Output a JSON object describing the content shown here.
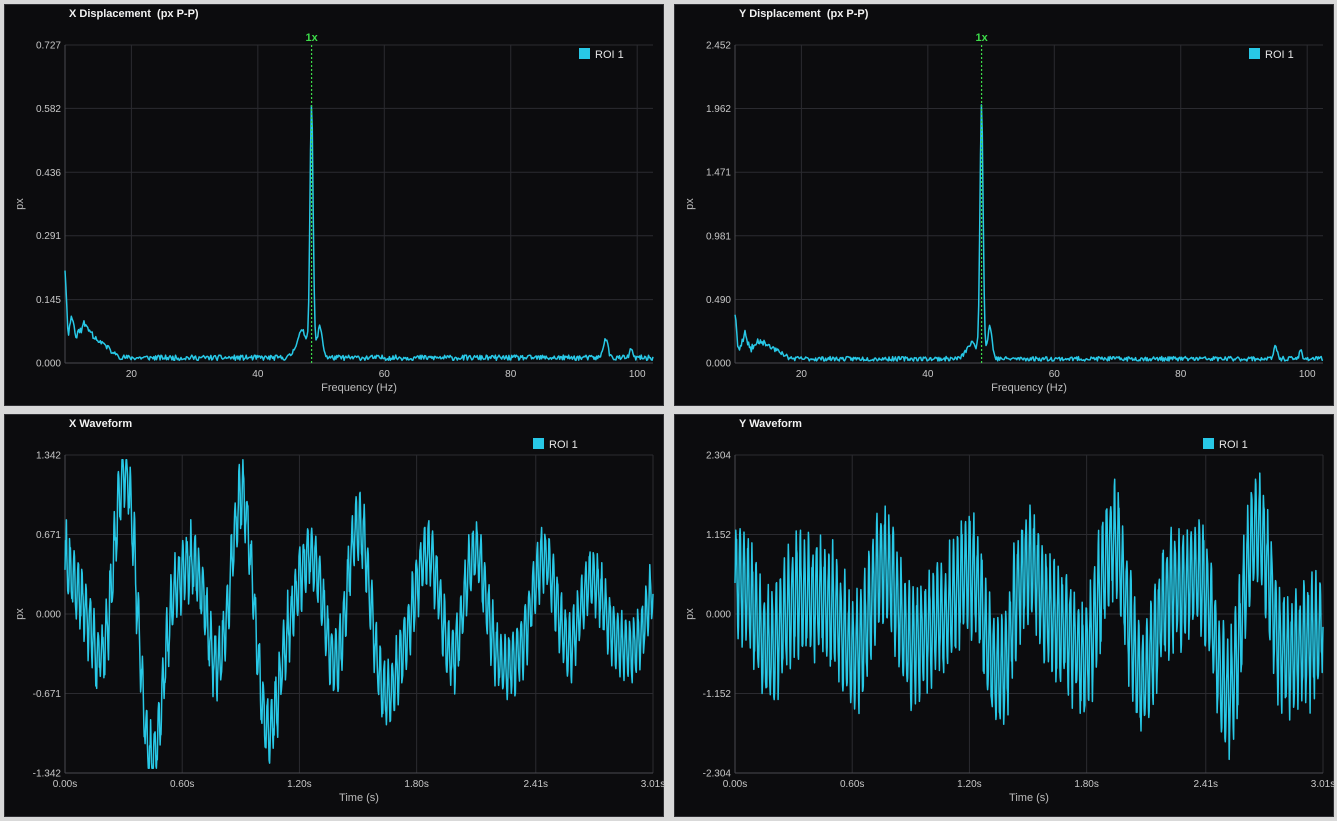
{
  "theme": {
    "background": "#0c0c0e",
    "grid": "#2b2b30",
    "series_color": "#28c8e6",
    "marker_color": "#3ddc4a"
  },
  "chart_data": [
    {
      "type": "line",
      "title": "X Displacement  (px P-P)",
      "xlabel": "Frequency (Hz)",
      "ylabel": "px",
      "xlim": [
        9.5,
        102.5
      ],
      "ylim": [
        0,
        0.727
      ],
      "xticks": [
        20,
        40,
        60,
        80,
        100
      ],
      "xtick_labels": [
        "20",
        "40",
        "60",
        "80",
        "100"
      ],
      "yticks": [
        0,
        0.145,
        0.291,
        0.436,
        0.582,
        0.727
      ],
      "ytick_labels": [
        "0.000",
        "0.145",
        "0.291",
        "0.436",
        "0.582",
        "0.727"
      ],
      "legend": "top-right",
      "marker": {
        "label": "1x",
        "x": 48.5
      },
      "series": [
        {
          "name": "ROI 1",
          "color": "#28c8e6",
          "peaks": [
            [
              9.5,
              0.19,
              0.3
            ],
            [
              10.5,
              0.07,
              0.6
            ],
            [
              12.5,
              0.06,
              1.5
            ],
            [
              15,
              0.03,
              2
            ],
            [
              48.5,
              0.57,
              0.35
            ],
            [
              47,
              0.06,
              1.2
            ],
            [
              49.8,
              0.07,
              0.6
            ],
            [
              95,
              0.045,
              0.5
            ],
            [
              99,
              0.02,
              0.3
            ]
          ],
          "base": 0.006,
          "noise": 0.012,
          "seed": 11,
          "points": 650
        }
      ]
    },
    {
      "type": "line",
      "title": "Y Displacement  (px P-P)",
      "xlabel": "Frequency (Hz)",
      "ylabel": "px",
      "xlim": [
        9.5,
        102.5
      ],
      "ylim": [
        0,
        2.452
      ],
      "xticks": [
        20,
        40,
        60,
        80,
        100
      ],
      "xtick_labels": [
        "20",
        "40",
        "60",
        "80",
        "100"
      ],
      "yticks": [
        0,
        0.49,
        0.981,
        1.471,
        1.962,
        2.452
      ],
      "ytick_labels": [
        "0.000",
        "0.490",
        "0.981",
        "1.471",
        "1.962",
        "2.452"
      ],
      "legend": "top-right",
      "marker": {
        "label": "1x",
        "x": 48.5
      },
      "series": [
        {
          "name": "ROI 1",
          "color": "#28c8e6",
          "peaks": [
            [
              9.5,
              0.32,
              0.3
            ],
            [
              11,
              0.15,
              0.7
            ],
            [
              13.5,
              0.12,
              1.4
            ],
            [
              16,
              0.06,
              1.5
            ],
            [
              48.5,
              1.95,
              0.35
            ],
            [
              47,
              0.12,
              1.2
            ],
            [
              49.8,
              0.25,
              0.5
            ],
            [
              95,
              0.09,
              0.4
            ],
            [
              99,
              0.07,
              0.3
            ]
          ],
          "base": 0.015,
          "noise": 0.035,
          "seed": 23,
          "points": 650
        }
      ]
    },
    {
      "type": "line",
      "title": "X Waveform",
      "xlabel": "Time (s)",
      "ylabel": "px",
      "xlim": [
        0,
        3.01
      ],
      "ylim": [
        -1.342,
        1.342
      ],
      "xticks": [
        0,
        0.6,
        1.2,
        1.8,
        2.41,
        3.01
      ],
      "xtick_labels": [
        "0.00s",
        "0.60s",
        "1.20s",
        "1.80s",
        "2.41s",
        "3.01s"
      ],
      "yticks": [
        -1.342,
        -0.671,
        0,
        0.671,
        1.342
      ],
      "ytick_labels": [
        "-1.342",
        "-0.671",
        "0.000",
        "0.671",
        "1.342"
      ],
      "legend": "top-right",
      "series": [
        {
          "name": "ROI 1",
          "color": "#28c8e6",
          "amp_start": 1.15,
          "amp_end": 0.3,
          "carrier_hz": 48.5,
          "carrier_amp": 0.33,
          "lf_hz": [
            3.3,
            1.7,
            5.1
          ],
          "seed": 7,
          "points": 1300
        }
      ]
    },
    {
      "type": "line",
      "title": "Y Waveform",
      "xlabel": "Time (s)",
      "ylabel": "px",
      "xlim": [
        0,
        3.01
      ],
      "ylim": [
        -2.304,
        2.304
      ],
      "xticks": [
        0,
        0.6,
        1.2,
        1.8,
        2.41,
        3.01
      ],
      "xtick_labels": [
        "0.00s",
        "0.60s",
        "1.20s",
        "1.80s",
        "2.41s",
        "3.01s"
      ],
      "yticks": [
        -2.304,
        -1.152,
        0,
        1.152,
        2.304
      ],
      "ytick_labels": [
        "-2.304",
        "-1.152",
        "0.000",
        "1.152",
        "2.304"
      ],
      "legend": "top-right",
      "series": [
        {
          "name": "ROI 1",
          "color": "#28c8e6",
          "amp_start": 0.45,
          "amp_end": 1.25,
          "carrier_hz": 48.5,
          "carrier_amp": 1.0,
          "lf_hz": [
            2.6,
            4.2
          ],
          "seed": 31,
          "points": 1500
        }
      ]
    }
  ]
}
